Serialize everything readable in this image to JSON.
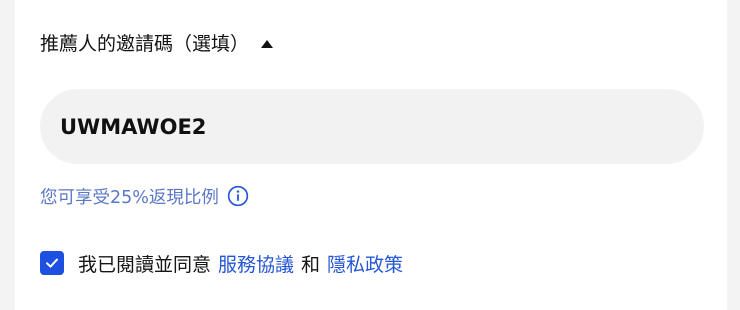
{
  "referral": {
    "title": "推薦人的邀請碼（選填）",
    "toggle_icon": "caret-up-icon",
    "code_value": "UWMAWOE2",
    "rebate_note": "您可享受25%返現比例",
    "info_icon": "info-circle-icon"
  },
  "agreement": {
    "checked": true,
    "text": "我已閱讀並同意",
    "terms_link": "服務協議",
    "and": "和",
    "privacy_link": "隱私政策"
  },
  "colors": {
    "link": "#2456d6",
    "note": "#5b77c8",
    "checkbox": "#1d4fe0",
    "input_bg": "#f2f2f3"
  }
}
